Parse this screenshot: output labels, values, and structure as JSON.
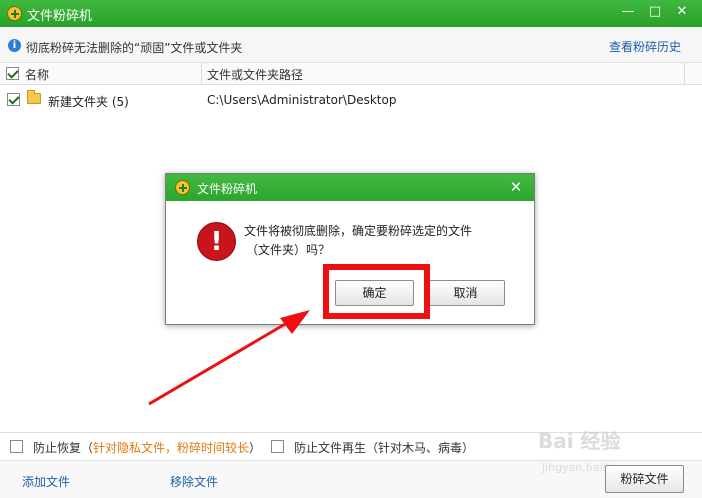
{
  "window": {
    "title": "文件粉碎机",
    "minimize_icon": "minimize-icon",
    "restore_icon": "restore-icon",
    "close_icon": "close-icon"
  },
  "info_bar": {
    "message": "彻底粉碎无法删除的“顽固”文件或文件夹",
    "history_link": "查看粉碎历史"
  },
  "file_list": {
    "columns": [
      "名称",
      "文件或文件夹路径"
    ],
    "rows": [
      {
        "checked": true,
        "name": "新建文件夹 (5)",
        "path": "C:\\Users\\Administrator\\Desktop"
      }
    ]
  },
  "options": {
    "prevent_recovery": {
      "checked": false,
      "label": "防止恢复（",
      "note": "针对隐私文件，粉碎时间较长",
      "close": "）"
    },
    "prevent_regeneration": {
      "checked": false,
      "label": "防止文件再生（针对木马、病毒）"
    }
  },
  "actions": {
    "add_file": "添加文件",
    "remove_file": "移除文件",
    "shred_file": "粉碎文件"
  },
  "dialog": {
    "title": "文件粉碎机",
    "message_line1": "文件将被彻底删除，确定要粉碎选定的文件",
    "message_line2": "（文件夹）吗？",
    "confirm_label": "确定",
    "cancel_label": "取消",
    "icon": "error-icon"
  },
  "annotation": {
    "highlight_color": "#ee1010",
    "arrow_color": "#ee1010"
  },
  "watermark": {
    "text": "Bai 经验",
    "sub": "jingyan.baidu.com"
  },
  "colors": {
    "titlebar_green": "#2aa22a",
    "link_blue": "#1f5ea8",
    "note_orange": "#e07a10",
    "error_red": "#c8141c"
  }
}
